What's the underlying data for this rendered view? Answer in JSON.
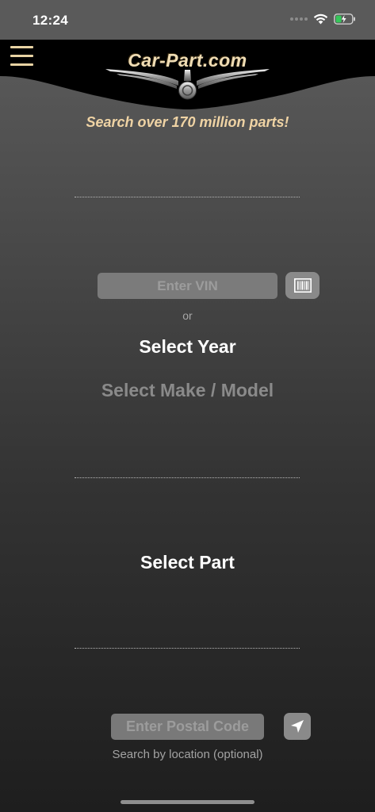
{
  "status_bar": {
    "time": "12:24",
    "icons": [
      "cellular-signal-icon",
      "wifi-icon",
      "battery-charging-icon"
    ]
  },
  "header": {
    "logo_text": "Car-Part.com",
    "tagline": "Search over 170 million parts!",
    "icons": [
      "hamburger-menu-icon",
      "winged-logo-icon"
    ],
    "colors": {
      "header_bg": "#000000",
      "accent_gold": "#efd3a4"
    }
  },
  "vehicle": {
    "vin_placeholder": "Enter VIN",
    "barcode_icon": "barcode-scan-icon",
    "or_label": "or",
    "select_year": "Select Year",
    "select_make_model": "Select Make / Model"
  },
  "part": {
    "select_part": "Select Part"
  },
  "location": {
    "postal_placeholder": "Enter Postal Code",
    "location_icon": "location-arrow-icon",
    "hint": "Search by location (optional)"
  }
}
